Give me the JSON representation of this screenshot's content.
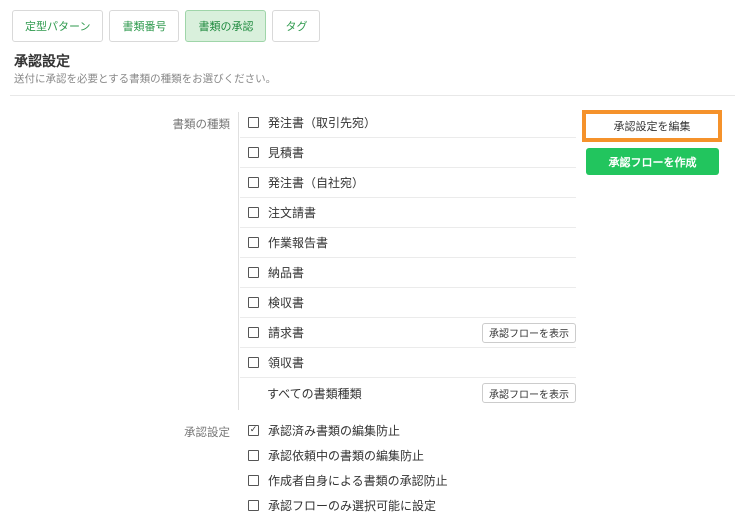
{
  "tabs": [
    {
      "label": "定型パターン",
      "active": false
    },
    {
      "label": "書類番号",
      "active": false
    },
    {
      "label": "書類の承認",
      "active": true
    },
    {
      "label": "タグ",
      "active": false
    }
  ],
  "header": {
    "title": "承認設定",
    "subtitle": "送付に承認を必要とする書類の種類をお選びください。"
  },
  "doc_types": {
    "label": "書類の種類",
    "items": [
      {
        "label": "発注書（取引先宛）",
        "checked": false,
        "flow_button": ""
      },
      {
        "label": "見積書",
        "checked": false,
        "flow_button": ""
      },
      {
        "label": "発注書（自社宛）",
        "checked": false,
        "flow_button": ""
      },
      {
        "label": "注文請書",
        "checked": false,
        "flow_button": ""
      },
      {
        "label": "作業報告書",
        "checked": false,
        "flow_button": ""
      },
      {
        "label": "納品書",
        "checked": false,
        "flow_button": ""
      },
      {
        "label": "検収書",
        "checked": false,
        "flow_button": ""
      },
      {
        "label": "請求書",
        "checked": false,
        "flow_button": "承認フローを表示"
      },
      {
        "label": "領収書",
        "checked": false,
        "flow_button": ""
      }
    ],
    "all_types": {
      "label": "すべての書類種類",
      "flow_button": "承認フローを表示"
    }
  },
  "buttons": {
    "edit": "承認設定を編集",
    "create_flow": "承認フローを作成"
  },
  "settings": {
    "label": "承認設定",
    "items": [
      {
        "label": "承認済み書類の編集防止",
        "checked": true
      },
      {
        "label": "承認依頼中の書類の編集防止",
        "checked": false
      },
      {
        "label": "作成者自身による書類の承認防止",
        "checked": false
      },
      {
        "label": "承認フローのみ選択可能に設定",
        "checked": false
      }
    ]
  },
  "colors": {
    "accent_green": "#22c55e",
    "highlight_orange": "#f5922b",
    "tab_active_bg": "#d9f0dc"
  }
}
